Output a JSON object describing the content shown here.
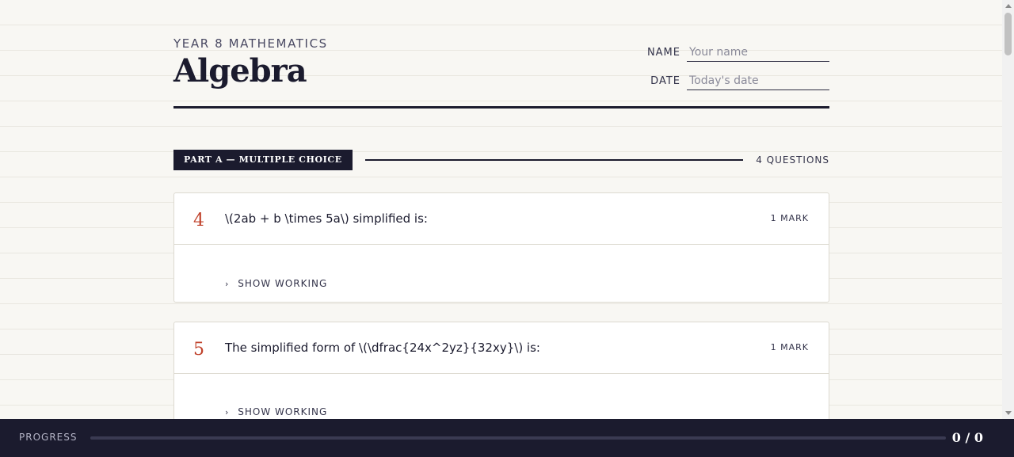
{
  "header": {
    "eyebrow": "YEAR 8 MATHEMATICS",
    "title": "Algebra",
    "name_label": "NAME",
    "name_placeholder": "Your name",
    "date_label": "DATE",
    "date_placeholder": "Today's date"
  },
  "part": {
    "badge": "PART A — MULTIPLE CHOICE",
    "count": "4 QUESTIONS"
  },
  "questions": [
    {
      "number": "4",
      "text": "\\(2ab + b \\times 5a\\) simplified is:",
      "marks": "1 MARK",
      "show_working": "SHOW WORKING"
    },
    {
      "number": "5",
      "text": "The simplified form of \\(\\dfrac{24x^2yz}{32xy}\\) is:",
      "marks": "1 MARK",
      "show_working": "SHOW WORKING"
    }
  ],
  "progress": {
    "label": "PROGRESS",
    "count": "0 / 0",
    "fraction": 0
  },
  "icons": {
    "show_working": "chevron-right-icon",
    "scroll_up": "arrow-up-icon",
    "scroll_down": "arrow-down-icon"
  },
  "colors": {
    "ink": "#1b1b2e",
    "accent": "#c0422b",
    "paper": "#f8f7f3"
  }
}
